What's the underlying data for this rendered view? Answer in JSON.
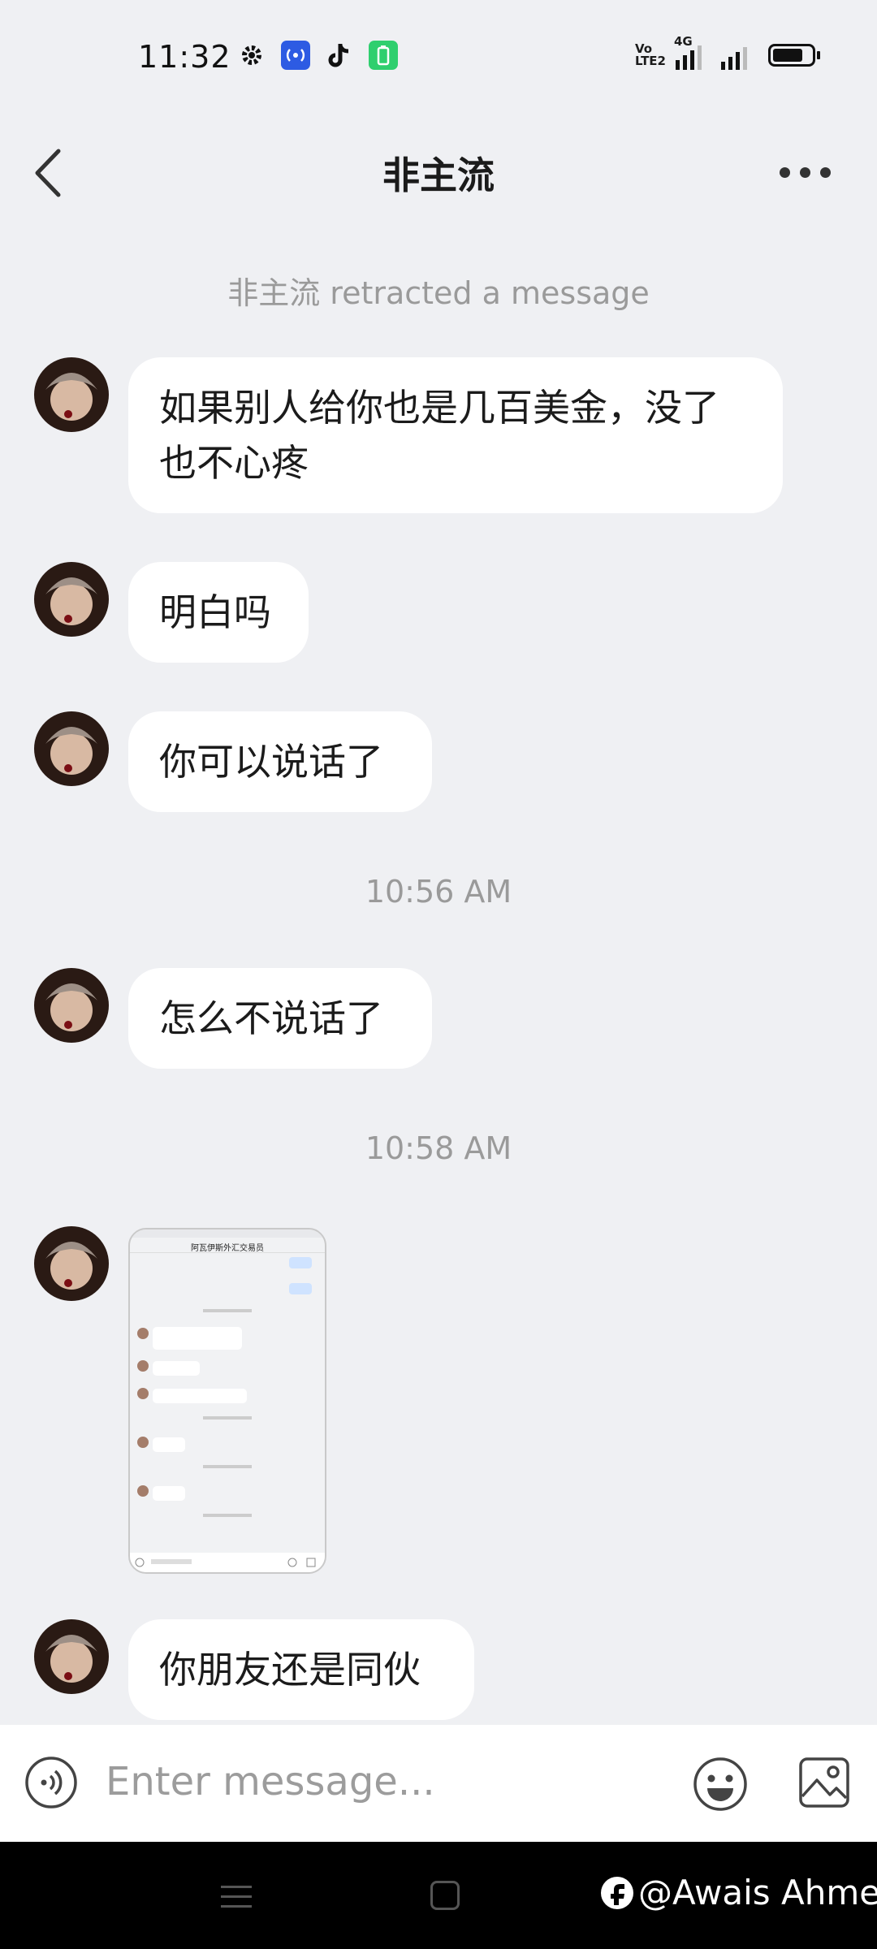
{
  "status_bar": {
    "time": "11:32",
    "icons": [
      "settings-icon",
      "hotspot-icon",
      "tiktok-icon",
      "battery-saver-icon"
    ],
    "network": "4G",
    "volte": "Vo LTE2"
  },
  "header": {
    "title": "非主流"
  },
  "chat": {
    "retracted_notice": "非主流 retracted a message",
    "messages": [
      {
        "type": "text",
        "text": "如果别人给你也是几百美金，没了也不心疼"
      },
      {
        "type": "text",
        "text": "明白吗"
      },
      {
        "type": "text",
        "text": "你可以说话了"
      },
      {
        "type": "time",
        "text": "10:56 AM"
      },
      {
        "type": "text",
        "text": "怎么不说话了"
      },
      {
        "type": "time",
        "text": "10:58 AM"
      },
      {
        "type": "image",
        "title": "阿瓦伊斯外汇交易员"
      },
      {
        "type": "text",
        "text": "你朋友还是同伙"
      }
    ]
  },
  "input": {
    "placeholder": "Enter message..."
  },
  "watermark": {
    "text": "@Awais Ahmed"
  },
  "colors": {
    "background": "#eff0f3",
    "bubble": "#ffffff",
    "system_text": "#9a9a9a"
  }
}
